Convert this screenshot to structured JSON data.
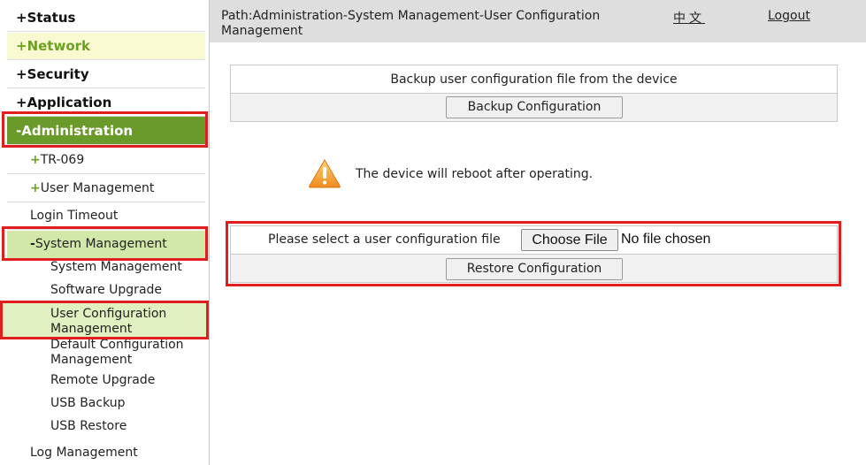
{
  "sidebar": {
    "top_items": [
      {
        "sign": "+",
        "label": "Status"
      },
      {
        "sign": "+",
        "label": "Network"
      },
      {
        "sign": "+",
        "label": "Security"
      },
      {
        "sign": "+",
        "label": "Application"
      },
      {
        "sign": "-",
        "label": "Administration"
      }
    ],
    "admin_children": [
      {
        "sign": "+",
        "label": "TR-069"
      },
      {
        "sign": "+",
        "label": "User Management"
      },
      {
        "sign": "",
        "label": "Login Timeout"
      },
      {
        "sign": "-",
        "label": "System Management"
      }
    ],
    "system_management_children": [
      "System Management",
      "Software Upgrade",
      "User Configuration Management",
      "Default Configuration Management",
      "Remote Upgrade",
      "USB Backup",
      "USB Restore"
    ],
    "log_management": "Log Management"
  },
  "header": {
    "path": "Path:Administration-System Management-User Configuration Management",
    "language": "中文",
    "logout": "Logout"
  },
  "backup": {
    "title": "Backup user configuration file from the device",
    "button": "Backup Configuration"
  },
  "warning": {
    "icon": "warning-icon",
    "text": "The device will reboot after operating."
  },
  "restore": {
    "label": "Please select a user configuration file",
    "choose_button": "Choose File",
    "file_status": "No file chosen",
    "button": "Restore Configuration"
  },
  "colors": {
    "admin_bg": "#6a9a2a",
    "network_bg": "#fafad2",
    "accent_green": "#6aa121",
    "selected_bg": "#d2e8a8",
    "highlight_red": "#e01e1e"
  }
}
